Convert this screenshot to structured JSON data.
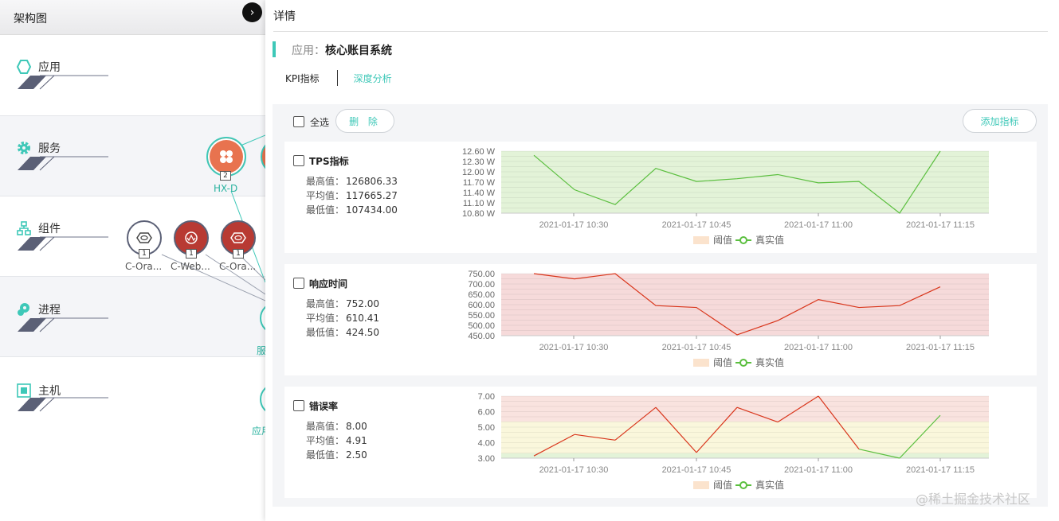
{
  "left_panel": {
    "title": "架构图",
    "layers": [
      {
        "label": "应用",
        "icon": "hexagon-icon"
      },
      {
        "label": "服务",
        "icon": "gear-icon"
      },
      {
        "label": "组件",
        "icon": "org-tree-icon"
      },
      {
        "label": "进程",
        "icon": "process-icon"
      },
      {
        "label": "主机",
        "icon": "host-chip-icon"
      }
    ],
    "nodes": [
      {
        "label": "HX-D",
        "badge": "2",
        "color": "#e8734f"
      },
      {
        "label": "C-Ora...",
        "badge": "1",
        "color": "#ffffff"
      },
      {
        "label": "C-Web...",
        "badge": "1",
        "color": "#b83a33"
      },
      {
        "label": "C-Ora...",
        "badge": "1",
        "color": "#b83a33"
      }
    ],
    "partial_labels": [
      "服",
      "应用"
    ]
  },
  "detail": {
    "title": "详情",
    "app_key": "应用：",
    "app_name": "核心账目系统",
    "tabs": {
      "kpi": "KPI指标",
      "deep": "深度分析"
    },
    "toolbar": {
      "select_all": "全选",
      "delete": "删 除",
      "add": "添加指标"
    },
    "legend": {
      "threshold": "阈值",
      "actual": "真实值"
    },
    "stat_labels": {
      "max": "最高值：",
      "avg": "平均值：",
      "min": "最低值："
    }
  },
  "accent_color": "#3ec8b8",
  "watermark": "@稀土掘金技术社区",
  "chart_data": [
    {
      "type": "line",
      "title": "TPS指标",
      "stats": {
        "max": "126806.33",
        "avg": "117665.27",
        "min": "107434.00"
      },
      "y_ticks": [
        "12.60 W",
        "12.30 W",
        "12.00 W",
        "11.70 W",
        "11.40 W",
        "11.10 W",
        "10.80 W"
      ],
      "ylim": [
        10.8,
        12.6
      ],
      "x_ticks": [
        "2021-01-17 10:30",
        "2021-01-17 10:45",
        "2021-01-17 11:00",
        "2021-01-17 11:15"
      ],
      "x": [
        "10:20",
        "10:25",
        "10:30",
        "10:35",
        "10:40",
        "10:45",
        "10:50",
        "10:55",
        "11:00",
        "11:05",
        "11:10",
        "11:15"
      ],
      "series": [
        {
          "values": [
            12.48,
            11.48,
            11.05,
            12.1,
            11.72,
            11.8,
            11.92,
            11.68,
            11.72,
            10.78,
            12.6,
            12.6
          ]
        }
      ],
      "line_color": "#5bbf3f",
      "band_color": "#e3f3d8"
    },
    {
      "type": "line",
      "title": "响应时间",
      "stats": {
        "max": "752.00",
        "avg": "610.41",
        "min": "424.50"
      },
      "y_ticks": [
        "750.00",
        "700.00",
        "650.00",
        "600.00",
        "550.00",
        "500.00",
        "450.00"
      ],
      "ylim": [
        420,
        750
      ],
      "x_ticks": [
        "2021-01-17 10:30",
        "2021-01-17 10:45",
        "2021-01-17 11:00",
        "2021-01-17 11:15"
      ],
      "x": [
        "10:20",
        "10:25",
        "10:30",
        "10:35",
        "10:40",
        "10:45",
        "10:50",
        "10:55",
        "11:00",
        "11:05",
        "11:10",
        "11:15"
      ],
      "series": [
        {
          "values": [
            750,
            722,
            752,
            580,
            570,
            424.5,
            500,
            612,
            570,
            580,
            680,
            680
          ]
        }
      ],
      "line_color": "#d9361c",
      "band_color": "#f6dada"
    },
    {
      "type": "line",
      "title": "错误率",
      "stats": {
        "max": "8.00",
        "avg": "4.91",
        "min": "2.50"
      },
      "y_ticks": [
        "7.00",
        "6.00",
        "5.00",
        "4.00",
        "3.00"
      ],
      "ylim": [
        2.5,
        8.0
      ],
      "x_ticks": [
        "2021-01-17 10:30",
        "2021-01-17 10:45",
        "2021-01-17 11:00",
        "2021-01-17 11:15"
      ],
      "x": [
        "10:20",
        "10:25",
        "10:30",
        "10:35",
        "10:40",
        "10:45",
        "10:50",
        "10:55",
        "11:00",
        "11:05",
        "11:10",
        "11:15"
      ],
      "series": [
        {
          "values": [
            2.7,
            4.6,
            4.1,
            7.0,
            3.0,
            7.0,
            5.7,
            8.0,
            3.3,
            2.5,
            6.3,
            6.3
          ]
        }
      ],
      "line_color": "#d9361c",
      "band_color": "#f6dada"
    }
  ]
}
